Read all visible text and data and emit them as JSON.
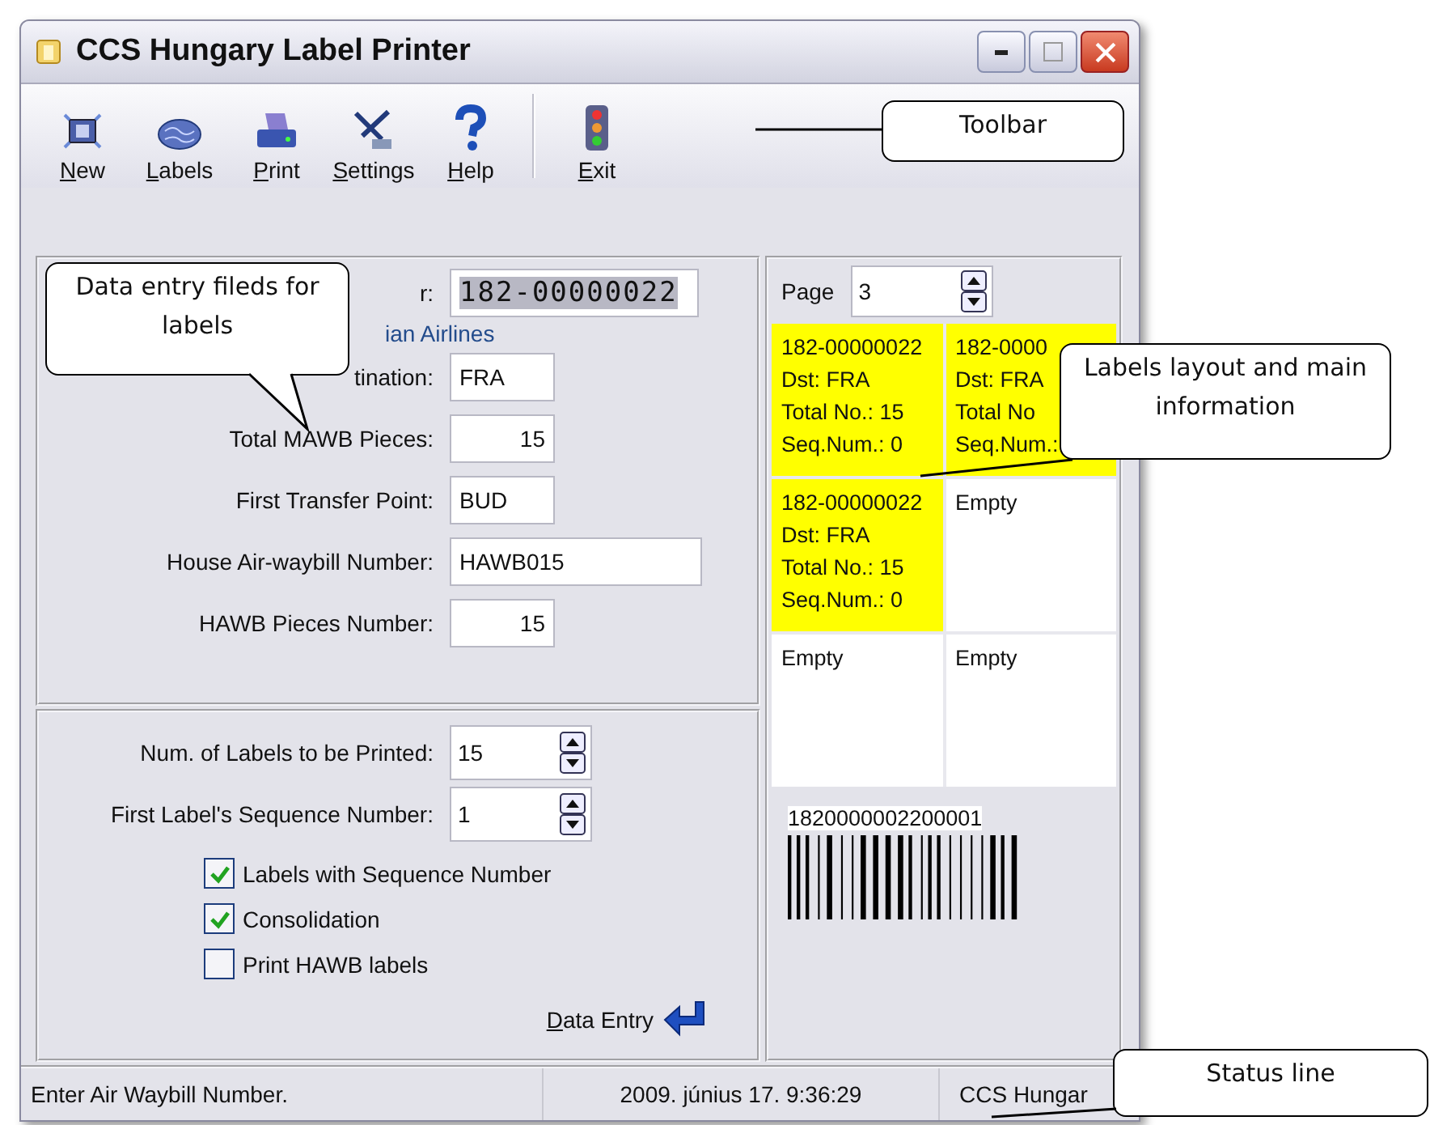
{
  "window": {
    "title": "CCS Hungary Label Printer"
  },
  "toolbar": [
    {
      "label": "New",
      "kind": "new"
    },
    {
      "label": "Labels",
      "kind": "labels"
    },
    {
      "label": "Print",
      "kind": "print"
    },
    {
      "label": "Settings",
      "kind": "settings"
    },
    {
      "label": "Help",
      "kind": "help"
    },
    {
      "label": "Exit",
      "kind": "exit"
    }
  ],
  "entry_form": {
    "fields": [
      {
        "label": "r:",
        "value": "182-00000022",
        "kind": "mawb",
        "selected": true
      },
      {
        "label": "tination:",
        "value": "FRA",
        "kind": "text",
        "selected": false
      },
      {
        "label": "Total MAWB Pieces:",
        "value": "15",
        "kind": "number",
        "selected": false
      },
      {
        "label": "First Transfer Point:",
        "value": "BUD",
        "kind": "text",
        "selected": false
      },
      {
        "label": "House Air-waybill Number:",
        "value": "HAWB015",
        "kind": "wide",
        "selected": false
      },
      {
        "label": "HAWB Pieces Number:",
        "value": "15",
        "kind": "number",
        "selected": false
      }
    ],
    "airline": "ian Airlines"
  },
  "print_options": {
    "spinners": [
      {
        "label": "Num. of Labels to be Printed:",
        "value": "15"
      },
      {
        "label": "First Label's Sequence Number:",
        "value": "1"
      }
    ],
    "checkboxes": [
      {
        "label": "Labels with Sequence Number",
        "checked": true
      },
      {
        "label": "Consolidation",
        "checked": true
      },
      {
        "label": "Print HAWB labels",
        "checked": false
      }
    ],
    "data_entry_button": "Data Entry"
  },
  "preview": {
    "page_label": "Page",
    "page_value": "3",
    "labels": [
      {
        "filled": true,
        "lines": [
          "182-00000022",
          "Dst: FRA",
          "Total No.: 15",
          "Seq.Num.: 0"
        ]
      },
      {
        "filled": true,
        "lines": [
          "182-0000",
          "Dst: FRA",
          "Total No",
          "Seq.Num.:"
        ]
      },
      {
        "filled": true,
        "lines": [
          "182-00000022",
          "Dst: FRA",
          "Total No.: 15",
          "Seq.Num.: 0"
        ]
      },
      {
        "filled": false,
        "lines": [
          "Empty"
        ]
      },
      {
        "filled": false,
        "lines": [
          "Empty"
        ]
      },
      {
        "filled": false,
        "lines": [
          "Empty"
        ]
      }
    ],
    "barcode": "1820000002200001"
  },
  "status_bar": [
    "Enter Air Waybill Number.",
    "2009. június 17.  9:36:29",
    "CCS Hungar"
  ],
  "callouts": [
    {
      "kind": "toolbar",
      "text": "Toolbar"
    },
    {
      "kind": "entry",
      "text": "Data entry fileds for labels"
    },
    {
      "kind": "layout",
      "text": "Labels layout and main information"
    },
    {
      "kind": "status",
      "text": "Status line"
    }
  ]
}
